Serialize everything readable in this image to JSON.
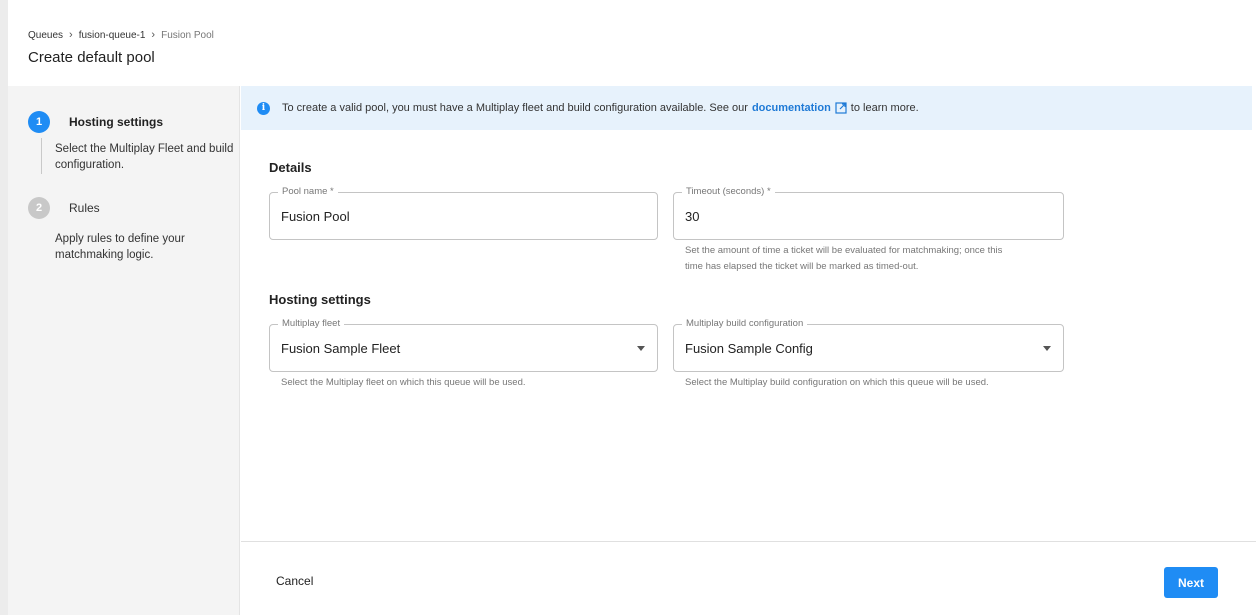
{
  "breadcrumb": {
    "items": [
      "Queues",
      "fusion-queue-1"
    ],
    "current": "Fusion Pool",
    "separator": "›"
  },
  "page_title": "Create default pool",
  "stepper": {
    "steps": [
      {
        "number": "1",
        "label": "Hosting settings",
        "description": "Select the Multiplay Fleet and build configuration.",
        "state": "active"
      },
      {
        "number": "2",
        "label": "Rules",
        "description": "Apply rules to define your matchmaking logic.",
        "state": "inactive"
      }
    ]
  },
  "info_banner": {
    "icon": "info-icon",
    "text_before": "To create a valid pool, you must have a Multiplay fleet and build configuration available. See our",
    "link_text": "documentation",
    "link_icon": "external-link-icon",
    "text_after": "to learn more."
  },
  "details": {
    "title": "Details",
    "pool_name": {
      "label": "Pool name *",
      "value": "Fusion Pool"
    },
    "timeout": {
      "label": "Timeout (seconds) *",
      "value": "30",
      "helper_line1": "Set the amount of time a ticket will be evaluated for matchmaking; once this",
      "helper_line2": "time has elapsed the ticket will be marked as timed-out."
    }
  },
  "hosting": {
    "title": "Hosting settings",
    "fleet": {
      "label": "Multiplay fleet",
      "value": "Fusion Sample Fleet",
      "helper": "Select the Multiplay fleet on which this queue will be used."
    },
    "build_config": {
      "label": "Multiplay build configuration",
      "value": "Fusion Sample Config",
      "helper": "Select the Multiplay build configuration on which this queue will be used."
    }
  },
  "footer": {
    "cancel_label": "Cancel",
    "next_label": "Next"
  },
  "colors": {
    "accent": "#1f8cf4",
    "banner_bg": "#e7f2fc",
    "link": "#1f7ad6"
  }
}
